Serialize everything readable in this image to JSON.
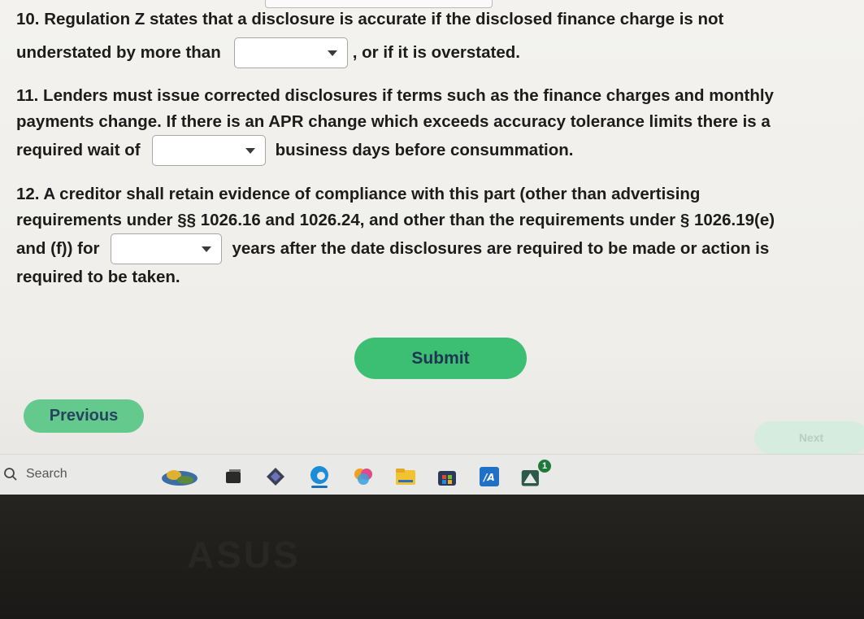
{
  "questions": [
    {
      "line1": "10. Regulation Z states that a disclosure is accurate if the disclosed finance charge is not",
      "before": "understated by more than",
      "after": ", or if it is overstated."
    },
    {
      "line1": "11. Lenders must issue corrected disclosures if terms such as the finance charges and monthly",
      "line2": "payments change. If there is an APR change which exceeds accuracy tolerance limits there is a",
      "before": "required wait of",
      "after": "business days before consummation."
    },
    {
      "line1": "12. A creditor shall retain evidence of compliance with this part (other than advertising",
      "line2": "requirements under §§ 1026.16 and 1026.24, and other than the requirements under § 1026.19(e)",
      "before": "and (f)) for",
      "after": "years after the date disclosures are required to be made or action is",
      "line4": "required to be taken."
    }
  ],
  "buttons": {
    "submit": "Submit",
    "previous": "Previous",
    "next": "Next"
  },
  "taskbar": {
    "search_label": "Search",
    "store_badge": "1",
    "icons": [
      "widgets-icon",
      "task-view-icon",
      "copilot-icon",
      "edge-icon",
      "photos-icon",
      "file-explorer-icon",
      "store-icon",
      "app-icon",
      "store-app-icon"
    ]
  },
  "brand": "ASUS",
  "colors": {
    "submit_bg": "#3cbf72",
    "previous_bg": "#64c98d",
    "next_disabled_bg": "#d6ecde",
    "text": "#1c1c1c"
  }
}
